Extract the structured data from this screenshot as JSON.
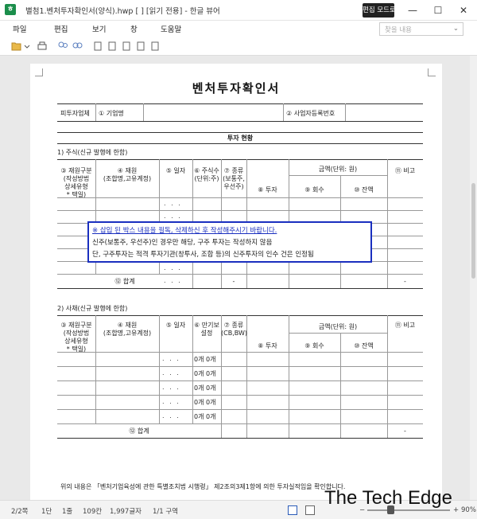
{
  "window": {
    "title": "별첨1.벤처투자확인서(양식).hwp [                                                        ] [읽기 전용] - 한글 뷰어",
    "edit_mode_button": "편집 모드로 열기",
    "minimize": "—",
    "maximize": "☐",
    "close": "✕"
  },
  "menu": {
    "items": [
      "파일",
      "편집",
      "보기",
      "창",
      "도움말"
    ],
    "find_placeholder": "찾을 내용"
  },
  "document": {
    "title": "벤처투자확인서",
    "company_section": {
      "label": "피투자업체",
      "field1": "① 기업명",
      "field2": "② 사업자등록번호"
    },
    "status_header": "투자 현황",
    "stock": {
      "section": "1) 주식(신규 발행에 한함)",
      "col_fund": "③ 재원구분\n(작성방법\n상세유형\n* 택일)",
      "col_source": "④ 재원\n(조합명,고유계정)",
      "col_date": "⑤ 일자",
      "col_count": "⑥ 주식수\n(단위:주)",
      "col_type": "⑦ 종류\n(보통주,\n우선주)",
      "col_amount": "금액(단위: 원)",
      "col_invest": "⑧ 투자",
      "col_recover": "⑨ 회수",
      "col_balance": "⑩ 잔액",
      "col_note": "⑪ 비고",
      "dots": ". . .",
      "total_label": "⑫ 합계",
      "total_dash": "-",
      "total_dash2": "-"
    },
    "notice": {
      "line1": "※ 삽입 된 박스 내용을 필독, 삭제하신 후 작성해주시기 바랍니다.",
      "line2": "신주(보통주, 우선주)인 경우만 해당, 구주 투자는 작성하지 않음",
      "line3": "단, 구주투자는 적격 투자기관(창투사, 조합 등)의 신주투자의 인수 건은 인정됨"
    },
    "bond": {
      "section": "2) 사채(신규 발행에 한함)",
      "col_fund": "③ 재원구분\n(작성방법\n상세유형\n* 택일)",
      "col_source": "④ 재원\n(조합명,고유계정)",
      "col_date": "⑤ 일자",
      "col_period": "⑥ 만기보\n설정",
      "col_type": "⑦ 종류\n(CB,BW)",
      "col_amount": "금액(단위: 원)",
      "col_invest": "⑧ 투자",
      "col_recover": "⑨ 회수",
      "col_balance": "⑩ 잔액",
      "col_note": "⑪ 비고",
      "dots": ". . .",
      "period_cell": "0개 0개",
      "total_label": "⑫ 합계",
      "total_dash": "-"
    },
    "footer_text": "위의 내용은 「벤처기업육성에 관한 특별조치법 시행령」 제2조의3제1항에 의한 투자실적임을 확인합니다."
  },
  "status": {
    "page": "2/2쪽",
    "section": "1단",
    "line": "1줄",
    "column": "109칸",
    "chars": "1,997글자",
    "area": "1/1 구역",
    "zoom": "90%",
    "zoom_level": 0.28,
    "watermark": "The Tech Edge"
  }
}
